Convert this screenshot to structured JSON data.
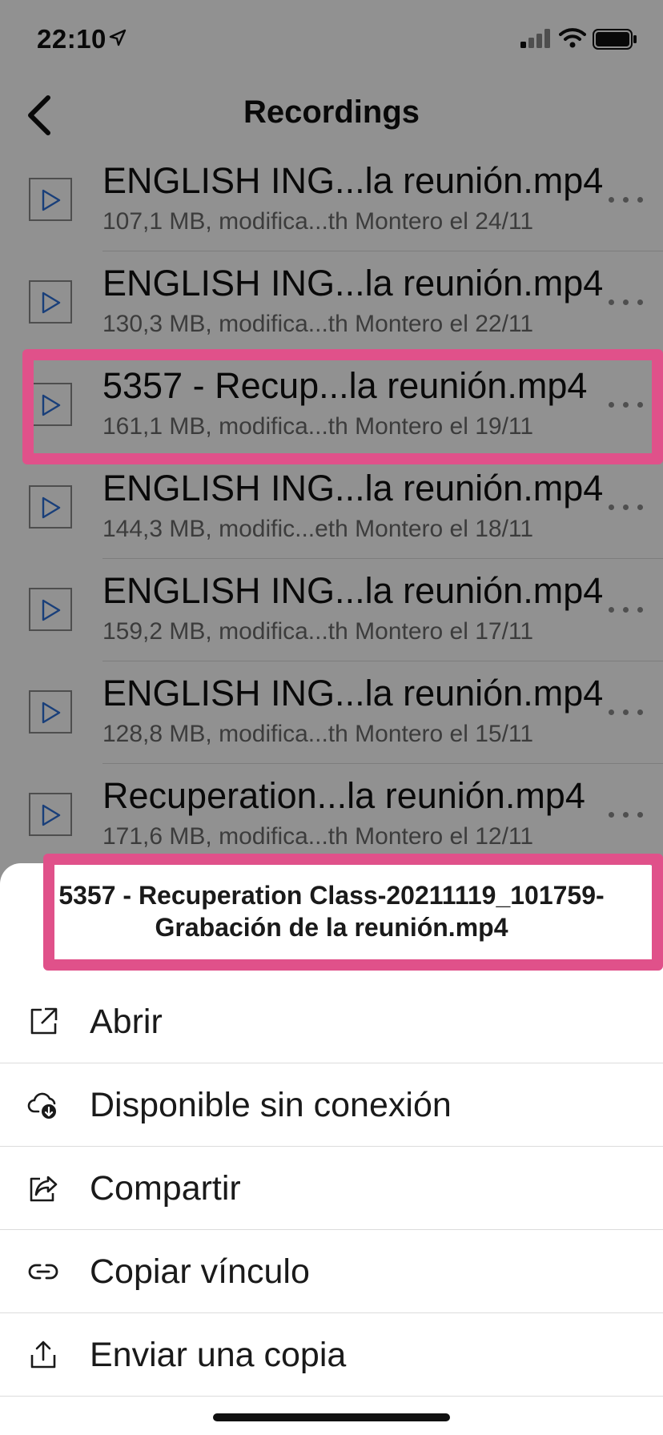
{
  "status_bar": {
    "time": "22:10"
  },
  "nav": {
    "title": "Recordings"
  },
  "files": [
    {
      "name": "ENGLISH ING...la reunión.mp4",
      "meta": "107,1 MB, modifica...th Montero el 24/11"
    },
    {
      "name": "ENGLISH ING...la reunión.mp4",
      "meta": "130,3 MB, modifica...th Montero el 22/11"
    },
    {
      "name": "5357 - Recup...la reunión.mp4",
      "meta": "161,1 MB, modifica...th Montero el 19/11"
    },
    {
      "name": "ENGLISH ING...la reunión.mp4",
      "meta": "144,3 MB, modific...eth Montero el 18/11"
    },
    {
      "name": "ENGLISH ING...la reunión.mp4",
      "meta": "159,2 MB, modifica...th Montero el 17/11"
    },
    {
      "name": "ENGLISH ING...la reunión.mp4",
      "meta": "128,8 MB, modifica...th Montero el 15/11"
    },
    {
      "name": "Recuperation...la reunión.mp4",
      "meta": "171,6 MB, modifica...th Montero el 12/11"
    }
  ],
  "sheet": {
    "file_name_line1": "5357 - Recuperation Class-20211119_101759-",
    "file_name_line2": "Grabación de la reunión.mp4",
    "options": [
      {
        "label": "Abrir",
        "icon": "open-external-icon"
      },
      {
        "label": "Disponible sin conexión",
        "icon": "cloud-download-icon"
      },
      {
        "label": "Compartir",
        "icon": "share-icon"
      },
      {
        "label": "Copiar vínculo",
        "icon": "link-icon"
      },
      {
        "label": "Enviar una copia",
        "icon": "send-copy-icon"
      }
    ]
  },
  "colors": {
    "highlight": "#e0518a",
    "overlay": "rgba(0,0,0,0.43)",
    "thumb_accent": "#2d6fd6"
  }
}
